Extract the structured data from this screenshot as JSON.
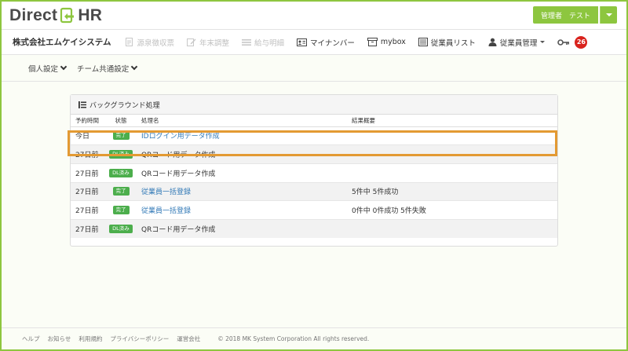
{
  "brand": {
    "left": "Direct",
    "right": "HR"
  },
  "user": {
    "label": "管理者　テスト"
  },
  "nav": {
    "company": "株式会社エムケイシステム",
    "items": [
      {
        "label": "源泉徴収票"
      },
      {
        "label": "年末調整"
      },
      {
        "label": "給与明細"
      },
      {
        "label": "マイナンバー"
      },
      {
        "label": "mybox"
      },
      {
        "label": "従業員リスト"
      },
      {
        "label": "従業員管理"
      }
    ],
    "badge_count": "26"
  },
  "subnav": {
    "items": [
      {
        "label": "個人設定"
      },
      {
        "label": "チーム共通設定"
      }
    ]
  },
  "panel": {
    "title": "バックグラウンド処理",
    "headers": {
      "time": "予約時間",
      "status": "状態",
      "name": "処理名",
      "result": "結果概要"
    },
    "rows": [
      {
        "time": "今日",
        "status": "完了",
        "name": "IDログイン用データ作成",
        "result": ""
      },
      {
        "time": "27日前",
        "status": "DL済み",
        "name": "QRコード用データ作成",
        "result": ""
      },
      {
        "time": "27日前",
        "status": "DL済み",
        "name": "QRコード用データ作成",
        "result": ""
      },
      {
        "time": "27日前",
        "status": "完了",
        "name": "従業員一括登録",
        "result": "5件中 5件成功"
      },
      {
        "time": "27日前",
        "status": "完了",
        "name": "従業員一括登録",
        "result": "0件中 0件成功 5件失敗"
      },
      {
        "time": "27日前",
        "status": "DL済み",
        "name": "QRコード用データ作成",
        "result": ""
      }
    ]
  },
  "footer": {
    "links": [
      {
        "label": "ヘルプ"
      },
      {
        "label": "お知らせ"
      },
      {
        "label": "利用規約"
      },
      {
        "label": "プライバシーポリシー"
      },
      {
        "label": "運営会社"
      }
    ],
    "copyright": "© 2018 MK System Corporation All rights reserved."
  },
  "colors": {
    "brand_green": "#8dc63f",
    "status_green": "#4cae4c",
    "highlight": "#e39a33",
    "badge_red": "#d9231d",
    "link": "#337ab7"
  }
}
